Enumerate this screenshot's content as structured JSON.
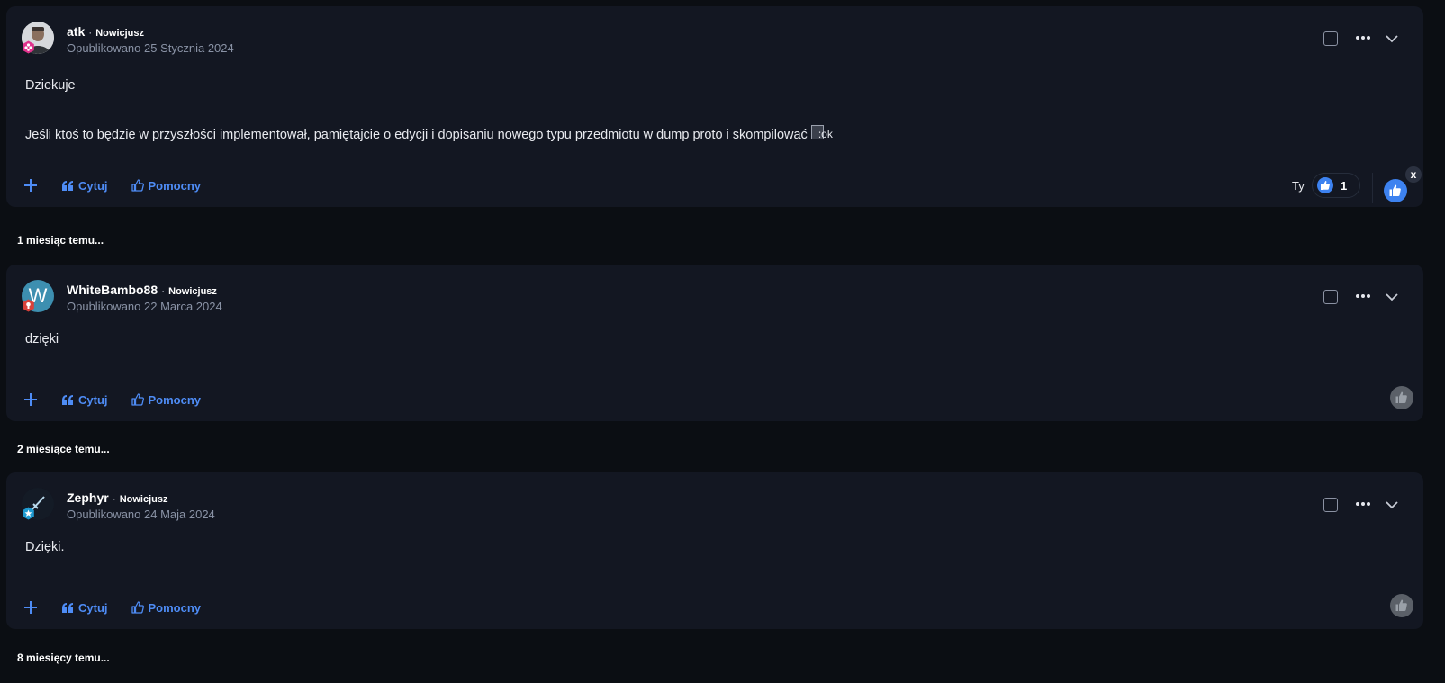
{
  "posts": [
    {
      "author": "atk",
      "rank": "Nowicjusz",
      "date": "Opublikowano 25 Stycznia 2024",
      "avatar_icon": "user-photo-icon",
      "badge_icon": "pink-flower-badge-icon",
      "badge_color": "#e0328c",
      "body": [
        "Dziekuje",
        "Jeśli ktoś to będzie w przyszłości implementował, pamiętajcie o edycji i dopisaniu nowego typu przedmiotu w dump proto i skompilować"
      ],
      "emoji_alt": ":ok",
      "actions": {
        "quote": "Cytuj",
        "helpful": "Pomocny"
      },
      "reaction": {
        "you_label": "Ty",
        "count": "1",
        "remove_label": "x",
        "active": true
      }
    },
    {
      "author": "WhiteBambo88",
      "rank": "Nowicjusz",
      "date": "Opublikowano 22 Marca 2024",
      "avatar_letter": "W",
      "avatar_color": "#3d8fb0",
      "badge_icon": "red-bulb-badge-icon",
      "badge_color": "#d8413a",
      "body": [
        "dzięki"
      ],
      "actions": {
        "quote": "Cytuj",
        "helpful": "Pomocny"
      },
      "reaction": {
        "active": false
      }
    },
    {
      "author": "Zephyr",
      "rank": "Nowicjusz",
      "date": "Opublikowano 24 Maja 2024",
      "avatar_icon": "sword-avatar-icon",
      "badge_icon": "blue-star-badge-icon",
      "badge_color": "#1f9bd1",
      "body": [
        "Dzięki."
      ],
      "actions": {
        "quote": "Cytuj",
        "helpful": "Pomocny"
      },
      "reaction": {
        "active": false
      }
    }
  ],
  "time_separators": [
    "1 miesiąc temu...",
    "2 miesiące temu...",
    "8 miesięcy temu..."
  ],
  "colors": {
    "page_bg": "#0b0e13",
    "card_bg": "#131722",
    "accent": "#4e8cf5",
    "like_active": "#3d82f0",
    "like_inactive": "#5b6068"
  }
}
